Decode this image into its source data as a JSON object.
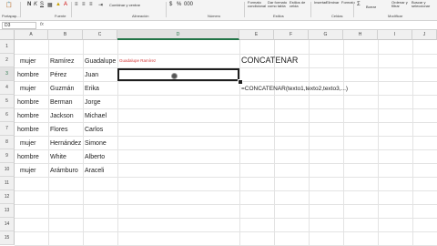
{
  "ribbon": {
    "clipboard_label": "Portapap...",
    "font_label": "Fuente",
    "alignment_label": "Alineación",
    "number_label": "Número",
    "styles_label": "Estilos",
    "cells_label": "Celdas",
    "editing_label": "Modificar",
    "combine_center": "Combinar y centrar",
    "conditional_format": "Formato condicional",
    "format_as_table": "Dar formato como tabla",
    "cell_styles": "Estilos de celda",
    "insert": "Insertar",
    "delete": "Eliminar",
    "format": "Formato",
    "clear": "Borrar",
    "sort_filter": "Ordenar y filtrar",
    "find_select": "Buscar y seleccionar"
  },
  "formula_bar": {
    "name_box": "D3",
    "fx": "fx",
    "content": ""
  },
  "columns": [
    "A",
    "B",
    "C",
    "D",
    "E",
    "F",
    "G",
    "H",
    "I",
    "J"
  ],
  "rows": [
    "1",
    "2",
    "3",
    "4",
    "5",
    "6",
    "7",
    "8",
    "9",
    "10",
    "11",
    "12",
    "13",
    "14",
    "15"
  ],
  "table": [
    {
      "a": "mujer",
      "b": "Ramírez",
      "c": "Guadalupe"
    },
    {
      "a": "hombre",
      "b": "Pérez",
      "c": "Juan"
    },
    {
      "a": "mujer",
      "b": "Guzmán",
      "c": "Erika"
    },
    {
      "a": "hombre",
      "b": "Berman",
      "c": "Jorge"
    },
    {
      "a": "hombre",
      "b": "Jackson",
      "c": "Michael"
    },
    {
      "a": "hombre",
      "b": "Flores",
      "c": "Carlos"
    },
    {
      "a": "mujer",
      "b": "Hernández",
      "c": "Simone"
    },
    {
      "a": "hombre",
      "b": "White",
      "c": "Alberto"
    },
    {
      "a": "mujer",
      "b": "Arámburo",
      "c": "Araceli"
    }
  ],
  "d2_text": "Guadalupe Ramírez",
  "e2_title": "CONCATENAR",
  "e4_syntax": "=CONCATENAR(texto1,texto2,texto3,...)"
}
